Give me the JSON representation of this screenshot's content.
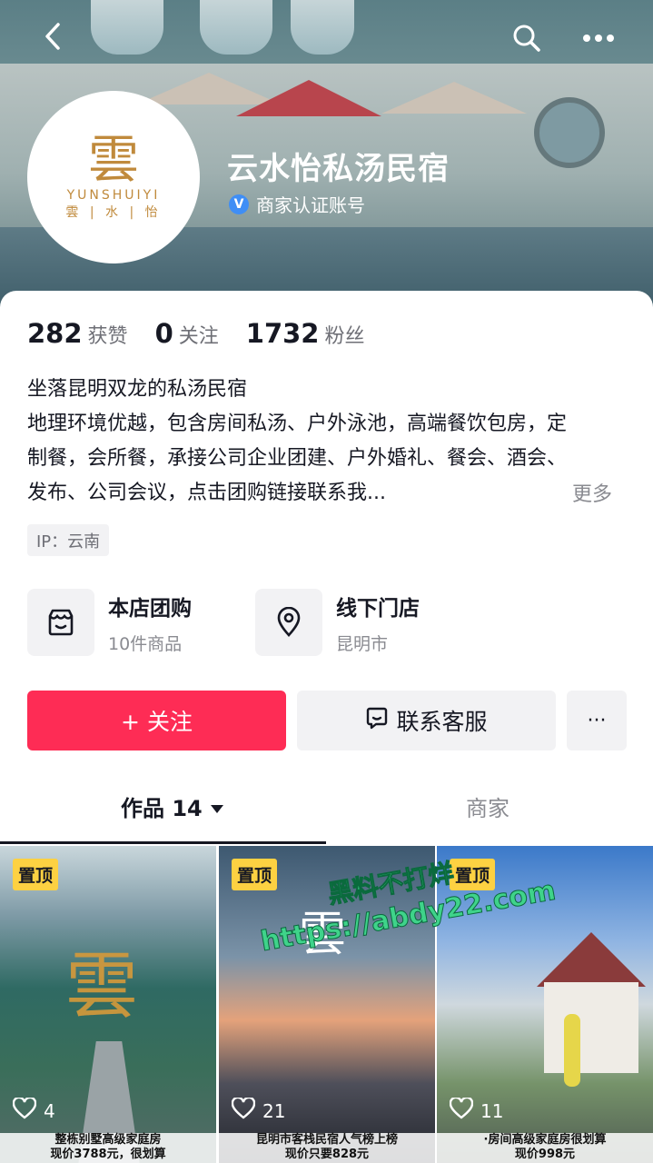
{
  "header": {
    "back_icon": "back-arrow-icon",
    "search_icon": "search-icon",
    "more_icon": "more-dots-icon",
    "avatar_logo": {
      "en": "YUNSHUIYI",
      "cn": "雲 | 水 | 怡"
    },
    "name": "云水怡私汤民宿",
    "verified_label": "商家认证账号"
  },
  "stats": [
    {
      "value": "282",
      "label": "获赞"
    },
    {
      "value": "0",
      "label": "关注"
    },
    {
      "value": "1732",
      "label": "粉丝"
    }
  ],
  "bio": {
    "line1": "坐落昆明双龙的私汤民宿",
    "line2": "地理环境优越，包含房间私汤、户外泳池，高端餐饮包房，定制餐，会所餐，承接公司企业团建、户外婚礼、餐会、酒会、发布、公司会议，点击团购链接联系我...",
    "more": "更多"
  },
  "ip": "IP：云南",
  "services": [
    {
      "title": "本店团购",
      "sub": "10件商品",
      "icon": "shop-icon"
    },
    {
      "title": "线下门店",
      "sub": "昆明市",
      "icon": "location-pin-icon"
    }
  ],
  "actions": {
    "follow": "+ 关注",
    "contact": "联系客服",
    "more": "···"
  },
  "tabs": [
    {
      "label": "作品 14"
    },
    {
      "label": "商家"
    }
  ],
  "videos": [
    {
      "pin": "置顶",
      "likes": "4",
      "caption": "整栋别墅高级家庭房\n现价3788元，很划算"
    },
    {
      "pin": "置顶",
      "likes": "21",
      "caption": "昆明市客栈民宿人气榜上榜\n现价只要828元"
    },
    {
      "pin": "置顶",
      "likes": "11",
      "caption": "·房间高级家庭房很划算\n现价998元"
    }
  ],
  "watermark": {
    "line1": "黑料不打烊",
    "line2": "https://abdy22.com"
  }
}
